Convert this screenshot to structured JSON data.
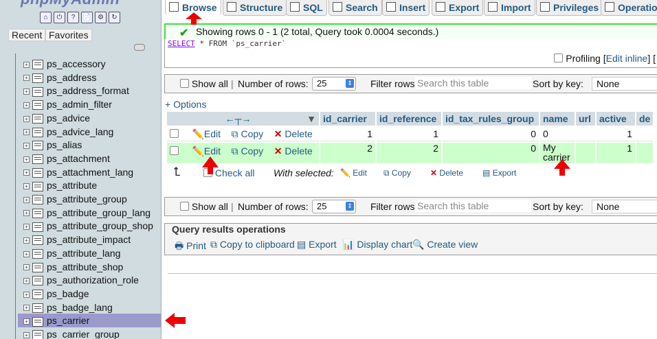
{
  "sidebar": {
    "logo": "phpMyAdmin",
    "tabs": [
      "Recent",
      "Favorites"
    ],
    "tables": [
      "ps_accessory",
      "ps_address",
      "ps_address_format",
      "ps_admin_filter",
      "ps_advice",
      "ps_advice_lang",
      "ps_alias",
      "ps_attachment",
      "ps_attachment_lang",
      "ps_attribute",
      "ps_attribute_group",
      "ps_attribute_group_lang",
      "ps_attribute_group_shop",
      "ps_attribute_impact",
      "ps_attribute_lang",
      "ps_attribute_shop",
      "ps_authorization_role",
      "ps_badge",
      "ps_badge_lang",
      "ps_carrier",
      "ps_carrier_group"
    ],
    "selected": "ps_carrier"
  },
  "tabs": [
    "Browse",
    "Structure",
    "SQL",
    "Search",
    "Insert",
    "Export",
    "Import",
    "Privileges",
    "Operatio"
  ],
  "active_tab": "Browse",
  "message": "Showing rows 0 - 1 (2 total, Query took 0.0004 seconds.)",
  "sql": {
    "keyword": "SELECT",
    "rest": " * FROM `ps_carrier`"
  },
  "profiling": {
    "label": "Profiling",
    "link": "Edit inline"
  },
  "nav": {
    "show_all": "Show all",
    "num_rows_label": "Number of rows:",
    "num_rows": "25",
    "filter_label": "Filter rows:",
    "filter_placeholder": "Search this table",
    "sort_label": "Sort by key:",
    "sort_value": "None"
  },
  "options_link": "+ Options",
  "columns": [
    "id_carrier",
    "id_reference",
    "id_tax_rules_group",
    "name",
    "url",
    "active",
    "de"
  ],
  "rows": [
    {
      "id_carrier": "1",
      "id_reference": "1",
      "id_tax_rules_group": "0",
      "name": "0",
      "url": "",
      "active": "1"
    },
    {
      "id_carrier": "2",
      "id_reference": "2",
      "id_tax_rules_group": "0",
      "name": "My carrier",
      "url": "",
      "active": "1"
    }
  ],
  "row_actions": {
    "edit": "Edit",
    "copy": "Copy",
    "delete": "Delete"
  },
  "bulk": {
    "check_all": "Check all",
    "with_selected": "With selected:",
    "edit": "Edit",
    "copy": "Copy",
    "delete": "Delete",
    "export": "Export"
  },
  "qro": {
    "legend": "Query results operations",
    "print": "Print",
    "copy": "Copy to clipboard",
    "export": "Export",
    "chart": "Display chart",
    "view": "Create view"
  }
}
